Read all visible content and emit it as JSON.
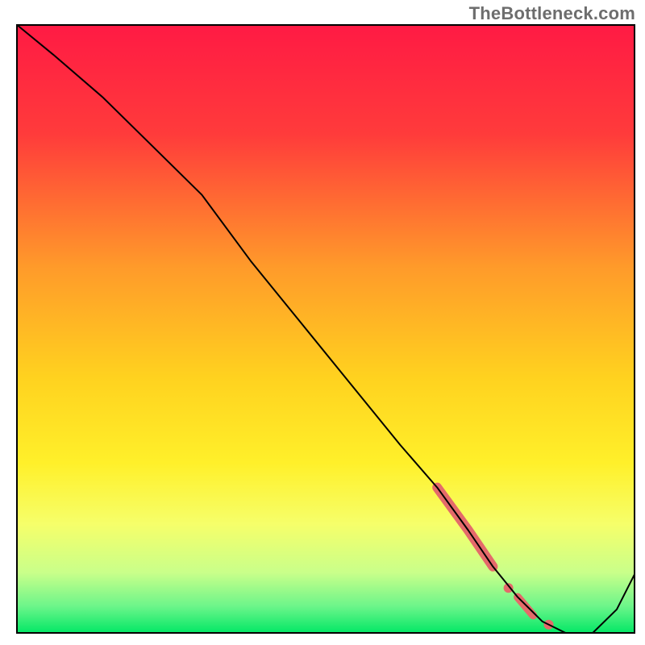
{
  "watermark": "TheBottleneck.com",
  "chart_data": {
    "type": "line",
    "title": "",
    "xlabel": "",
    "ylabel": "",
    "xlim": [
      0,
      100
    ],
    "ylim": [
      0,
      100
    ],
    "grid": false,
    "legend": false,
    "background_gradient": {
      "stops": [
        {
          "offset": 0.0,
          "color": "#ff1a44"
        },
        {
          "offset": 0.18,
          "color": "#ff3b3b"
        },
        {
          "offset": 0.4,
          "color": "#ff9b2a"
        },
        {
          "offset": 0.58,
          "color": "#ffd21f"
        },
        {
          "offset": 0.72,
          "color": "#fff02a"
        },
        {
          "offset": 0.82,
          "color": "#f6ff6a"
        },
        {
          "offset": 0.9,
          "color": "#c9ff8a"
        },
        {
          "offset": 0.955,
          "color": "#6cf58a"
        },
        {
          "offset": 1.0,
          "color": "#00e765"
        }
      ]
    },
    "series": [
      {
        "name": "bottleneck-curve",
        "color": "#000000",
        "width": 2.0,
        "x": [
          0,
          6,
          14,
          22,
          30,
          38,
          46,
          54,
          62,
          68,
          73,
          77,
          81,
          85,
          89,
          93,
          97,
          100
        ],
        "y": [
          100,
          95,
          88,
          80,
          72,
          61,
          51,
          41,
          31,
          24,
          17,
          11,
          6,
          2,
          0,
          0,
          4,
          10
        ]
      }
    ],
    "highlight_segments": [
      {
        "name": "main-highlight",
        "color": "#e46a6a",
        "width": 12,
        "x": [
          68,
          73,
          77
        ],
        "y": [
          24,
          17,
          11
        ]
      },
      {
        "name": "dot-1",
        "color": "#e46a6a",
        "radius": 6,
        "x": 79.5,
        "y": 7.5
      },
      {
        "name": "tail-highlight",
        "color": "#e46a6a",
        "width": 10,
        "x": [
          81,
          83.5
        ],
        "y": [
          6,
          3
        ]
      },
      {
        "name": "dot-2",
        "color": "#e46a6a",
        "radius": 6,
        "x": 86,
        "y": 1.5
      }
    ],
    "frame": {
      "color": "#000000",
      "width": 4
    }
  }
}
